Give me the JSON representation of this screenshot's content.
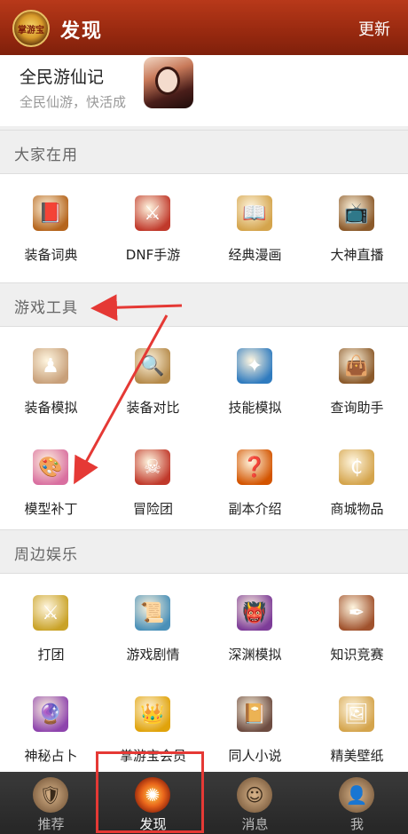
{
  "header": {
    "title": "发现",
    "update_label": "更新",
    "logo_text": "掌游宝"
  },
  "featured": {
    "name": "全民游仙记",
    "desc": "全民仙游，快活成"
  },
  "sections": [
    {
      "title": "大家在用",
      "items": [
        {
          "label": "装备词典",
          "icon": "book-icon",
          "glyph": "📕",
          "color": "#b5651d"
        },
        {
          "label": "DNF手游",
          "icon": "mobile-game-icon",
          "glyph": "⚔",
          "color": "#c0392b"
        },
        {
          "label": "经典漫画",
          "icon": "comic-icon",
          "glyph": "📖",
          "color": "#d4a44c"
        },
        {
          "label": "大神直播",
          "icon": "tv-icon",
          "glyph": "📺",
          "color": "#8b5a2b"
        }
      ]
    },
    {
      "title": "游戏工具",
      "items": [
        {
          "label": "装备模拟",
          "icon": "figure-icon",
          "glyph": "♟",
          "color": "#c8a07a"
        },
        {
          "label": "装备对比",
          "icon": "magnifier-icon",
          "glyph": "🔍",
          "color": "#b58a4a"
        },
        {
          "label": "技能模拟",
          "icon": "skill-icon",
          "glyph": "✦",
          "color": "#2f7bbf"
        },
        {
          "label": "查询助手",
          "icon": "bag-icon",
          "glyph": "👜",
          "color": "#8b5a2b"
        },
        {
          "label": "模型补丁",
          "icon": "palette-icon",
          "glyph": "🎨",
          "color": "#d96fa0"
        },
        {
          "label": "冒险团",
          "icon": "banner-icon",
          "glyph": "☠",
          "color": "#c0392b"
        },
        {
          "label": "副本介绍",
          "icon": "quest-book-icon",
          "glyph": "❓",
          "color": "#d35400"
        },
        {
          "label": "商城物品",
          "icon": "coin-icon",
          "glyph": "₵",
          "color": "#d4a44c"
        }
      ]
    },
    {
      "title": "周边娱乐",
      "items": [
        {
          "label": "打团",
          "icon": "crossed-swords-icon",
          "glyph": "⚔",
          "color": "#c9a227"
        },
        {
          "label": "游戏剧情",
          "icon": "scroll-icon",
          "glyph": "📜",
          "color": "#4a90b8"
        },
        {
          "label": "深渊模拟",
          "icon": "demon-icon",
          "glyph": "👹",
          "color": "#7d3c98"
        },
        {
          "label": "知识竞赛",
          "icon": "quill-icon",
          "glyph": "✒",
          "color": "#a0522d"
        },
        {
          "label": "神秘占卜",
          "icon": "crystal-ball-icon",
          "glyph": "🔮",
          "color": "#8e44ad"
        },
        {
          "label": "掌游宝会员",
          "icon": "crown-icon",
          "glyph": "👑",
          "color": "#e0a30b"
        },
        {
          "label": "同人小说",
          "icon": "novel-icon",
          "glyph": "📔",
          "color": "#6d4c41"
        },
        {
          "label": "精美壁纸",
          "icon": "wallpaper-icon",
          "glyph": "🖼",
          "color": "#d4a44c"
        }
      ]
    }
  ],
  "tabs": [
    {
      "label": "推荐",
      "icon": "shield-icon",
      "glyph": "🛡",
      "active": false
    },
    {
      "label": "发现",
      "icon": "discover-icon",
      "glyph": "✺",
      "active": true
    },
    {
      "label": "消息",
      "icon": "message-icon",
      "glyph": "☺",
      "active": false
    },
    {
      "label": "我",
      "icon": "profile-icon",
      "glyph": "👤",
      "active": false
    }
  ],
  "accent_color": "#a8311a",
  "annotation_color": "#e53935"
}
